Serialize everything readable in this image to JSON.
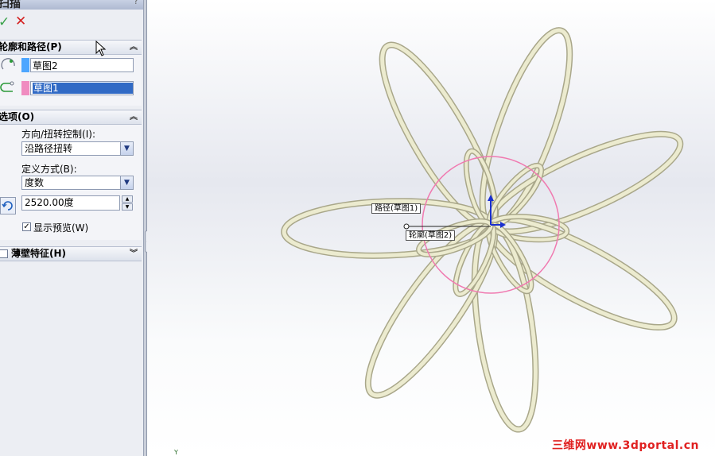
{
  "panel": {
    "title": "扫描",
    "help": "?",
    "ok_symbol": "✓",
    "cancel_symbol": "✕",
    "profile_path": {
      "header": "轮廓和路径(P)",
      "profile_value": "草图2",
      "path_value": "草图1",
      "profile_color": "#4da6ff",
      "path_color": "#f08cc0"
    },
    "options": {
      "header": "选项(O)",
      "orientation_label": "方向/扭转控制(I):",
      "orientation_value": "沿路径扭转",
      "define_label": "定义方式(B):",
      "define_value": "度数",
      "angle_value": "2520.00度",
      "preview_label": "显示预览(W)",
      "preview_checked": true
    },
    "thin_feature": {
      "header": "薄壁特征(H)"
    }
  },
  "viewport": {
    "callout_path": "路径(草图1)",
    "callout_profile": "轮廓(草图2)",
    "watermark": "三维网www.3dportal.cn",
    "axis_label": "Y",
    "accent_color": "#316ac5",
    "ring_color": "#f07ab0",
    "loop_color": "#e8e6c4"
  }
}
